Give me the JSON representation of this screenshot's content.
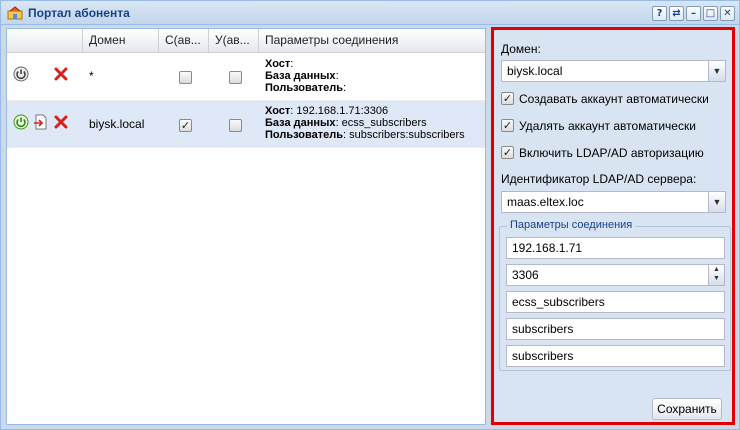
{
  "window": {
    "title": "Портал абонента",
    "tools": [
      "?",
      "⇄",
      "–",
      "□",
      "✕"
    ]
  },
  "grid": {
    "columns": [
      "",
      "Домен",
      "С(ав...",
      "У(ав...",
      "Параметры соединения"
    ],
    "rows": [
      {
        "domain": "*",
        "auto_create": false,
        "auto_delete": false,
        "host_label": "Хост",
        "host_value": ":",
        "db_label": "База данных",
        "db_value": ":",
        "user_label": "Пользователь",
        "user_value": ":",
        "icons": [
          "power-off-icon",
          "delete-icon"
        ]
      },
      {
        "domain": "biysk.local",
        "auto_create": true,
        "auto_delete": false,
        "host_label": "Хост",
        "host_value": ": 192.168.1.71:3306",
        "db_label": "База данных",
        "db_value": ": ecss_subscribers",
        "user_label": "Пользователь",
        "user_value": ": subscribers:subscribers",
        "icons": [
          "power-on-icon",
          "export-icon",
          "delete-icon"
        ]
      }
    ]
  },
  "form": {
    "domain_label": "Домен:",
    "domain_value": "biysk.local",
    "auto_create_label": "Создавать аккаунт автоматически",
    "auto_create": true,
    "auto_delete_label": "Удалять аккаунт автоматически",
    "auto_delete": true,
    "ldap_label": "Включить LDAP/AD авторизацию",
    "ldap": true,
    "server_id_label": "Идентификатор LDAP/AD сервера:",
    "server_id_value": "maas.eltex.loc",
    "conn_legend": "Параметры соединения",
    "host": "192.168.1.71",
    "port": "3306",
    "database": "ecss_subscribers",
    "user": "subscribers",
    "password": "subscribers",
    "save_label": "Сохранить"
  },
  "colors": {
    "highlight_border": "#e00000",
    "title_text": "#15428b",
    "selected_row": "#dfe8f6"
  }
}
